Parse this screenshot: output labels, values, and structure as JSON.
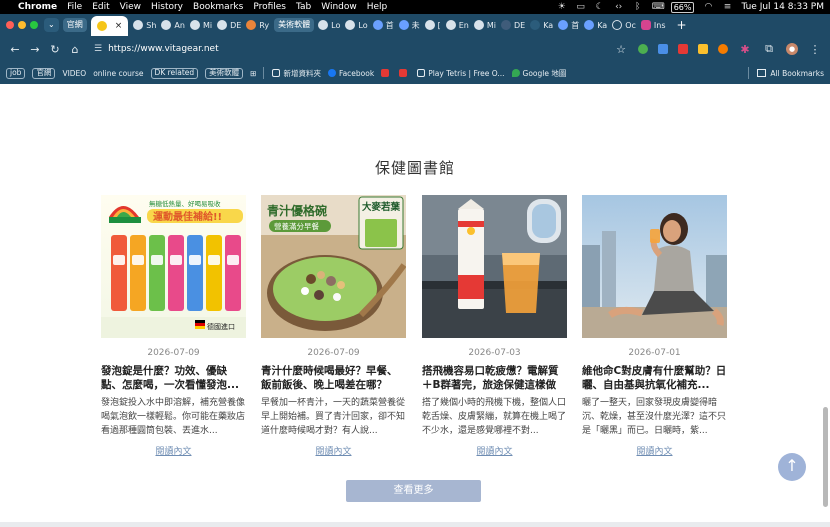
{
  "menubar": {
    "app": "Chrome",
    "items": [
      "File",
      "Edit",
      "View",
      "History",
      "Bookmarks",
      "Profiles",
      "Tab",
      "Window",
      "Help"
    ],
    "battery": "66%",
    "clock": "Tue Jul 14  8:33 PM"
  },
  "tabs": {
    "group_label": "官網",
    "group_label_2": "美術軟體",
    "items": [
      "Sh",
      "An",
      "Mi",
      "DE",
      "Ry",
      "Lo",
      "Lo",
      "首",
      "未",
      "[",
      "En",
      "Mi",
      "DE",
      "Ka",
      "首",
      "Ka",
      "Oc",
      "Ins"
    ],
    "new_tab": "+"
  },
  "toolbar": {
    "url": "https://www.vitagear.net"
  },
  "bookmarks": {
    "items": [
      "job",
      "官網",
      "VIDEO",
      "online course",
      "DK related",
      "美術軟體"
    ],
    "folder": "新增資料夾",
    "facebook": "Facebook",
    "tetris": "Play Tetris | Free O...",
    "google_map": "Google 地圖",
    "all": "All Bookmarks"
  },
  "page": {
    "section_title": "保健圖書館",
    "read_more": "閱讀內文",
    "more_button": "查看更多",
    "articles": [
      {
        "date": "2026-07-09",
        "title": "發泡錠是什麼？功效、優缺點、怎麼喝，一次看懂發泡...",
        "excerpt": "發泡錠投入水中即溶解，補充營養像喝氣泡飲一樣輕鬆。你可能在藥妝店看過那種圓筒包裝、丟進水...",
        "image_text": "無糖低熱量、好喝易吸收",
        "image_text_2": "運動最佳補給!!",
        "image_badge": "德國進口"
      },
      {
        "date": "2026-07-09",
        "title": "青汁什麼時候喝最好？早餐、飯前飯後、晚上喝差在哪？",
        "excerpt": "早餐加一杯青汁，一天的蔬菜營養從早上開始補。買了青汁回家，卻不知道什麼時候喝才對？有人說...",
        "image_text": "青汁優格碗",
        "image_text_2": "營養滿分早餐",
        "image_badge": "大麥若葉"
      },
      {
        "date": "2026-07-03",
        "title": "搭飛機容易口乾疲憊？電解質＋B群著完，旅途保健這樣做",
        "excerpt": "搭了幾個小時的飛機下機，整個人口乾舌燥、皮膚緊繃，就算在機上喝了不少水，還是感覺哪裡不對...",
        "image_text": "",
        "image_text_2": "",
        "image_badge": ""
      },
      {
        "date": "2026-07-01",
        "title": "維他命C對皮膚有什麼幫助？日曬、自由基與抗氧化補充...",
        "excerpt": "曬了一整天，回家發現皮膚變得暗沉、乾燥，甚至沒什麼光澤？這不只是「曬黑」而已。日曬時，紫...",
        "image_text": "",
        "image_text_2": "",
        "image_badge": ""
      }
    ]
  }
}
